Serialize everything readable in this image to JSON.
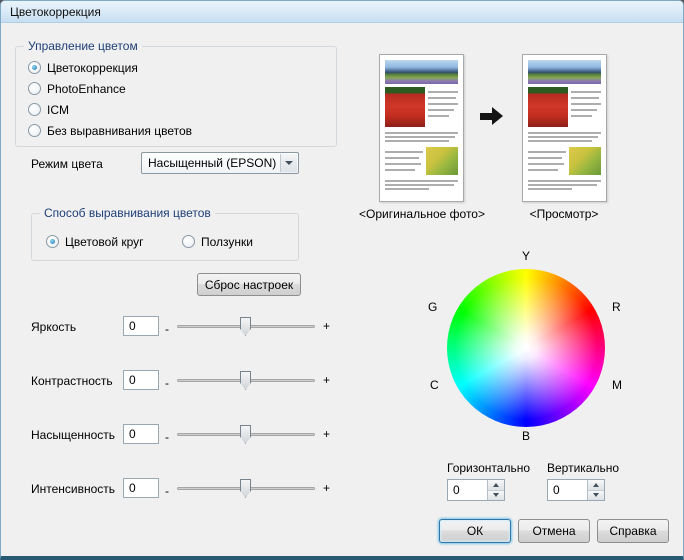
{
  "window": {
    "title": "Цветокоррекция"
  },
  "color_management": {
    "label": "Управление цветом",
    "options": [
      {
        "label": "Цветокоррекция",
        "selected": true
      },
      {
        "label": "PhotoEnhance",
        "selected": false
      },
      {
        "label": "ICM",
        "selected": false
      },
      {
        "label": "Без выравнивания цветов",
        "selected": false
      }
    ]
  },
  "color_mode": {
    "label": "Режим цвета",
    "value": "Насыщенный (EPSON)"
  },
  "method": {
    "label": "Способ выравнивания цветов",
    "options": [
      {
        "label": "Цветовой круг",
        "selected": true
      },
      {
        "label": "Ползунки",
        "selected": false
      }
    ]
  },
  "reset_button": {
    "label": "Сброс настроек"
  },
  "sliders": {
    "minus": "-",
    "plus": "+",
    "rows": [
      {
        "label": "Яркость",
        "value": "0"
      },
      {
        "label": "Контрастность",
        "value": "0"
      },
      {
        "label": "Насыщенность",
        "value": "0"
      },
      {
        "label": "Интенсивность",
        "value": "0"
      }
    ]
  },
  "previews": {
    "original_label": "<Оригинальное фото>",
    "preview_label": "<Просмотр>",
    "arrow_icon": "arrow-right"
  },
  "color_wheel": {
    "labels": {
      "top": "Y",
      "upper_right": "R",
      "lower_right": "M",
      "bottom": "B",
      "lower_left": "C",
      "upper_left": "G"
    },
    "center_marker": "+"
  },
  "offsets": {
    "horizontal": {
      "label": "Горизонтально",
      "value": "0"
    },
    "vertical": {
      "label": "Вертикально",
      "value": "0"
    }
  },
  "footer": {
    "ok": "ОК",
    "cancel": "Отмена",
    "help": "Справка"
  },
  "colors": {
    "accent": "#2177ae",
    "titlebar": "#d8e9f7",
    "dialog_bg": "#f0f0f0"
  }
}
